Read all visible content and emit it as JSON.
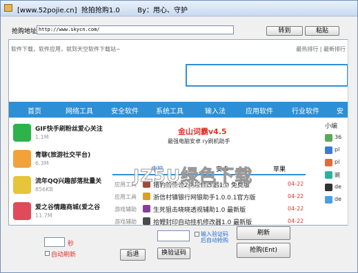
{
  "window": {
    "title": "[www.52pojie.cn]  抢拍抢购1.0        By：用心、守护"
  },
  "address": {
    "label": "抢购地址:",
    "value": "http://www.skycn.com/",
    "goto_label": "转到",
    "paste_label": "粘贴"
  },
  "browser": {
    "top_text": "软件下载，软件应用，就到天空软件下载站~",
    "top_links": "最热排行 | 最新排行",
    "nav": [
      "首页",
      "网络工具",
      "安全软件",
      "系统工具",
      "输入法",
      "应用软件",
      "行业软件",
      "安"
    ],
    "left_items": [
      {
        "name": "GIF快手刷粉丝爱心关注",
        "size": "1.1M",
        "icon": "gif-app-icon",
        "color": "#2eb34a"
      },
      {
        "name": "青聊(旅游社交平台)",
        "size": "6.3M",
        "icon": "dog-app-icon",
        "color": "#f0a33a"
      },
      {
        "name": "流年QQ兴趣部落批量关",
        "size": "856KB",
        "icon": "zhiyi-app-icon",
        "color": "#e6c53a"
      },
      {
        "name": "爱之谷情趣商城(爱之谷",
        "size": "11.7M",
        "icon": "heart-app-icon",
        "color": "#e04b5a"
      }
    ],
    "featured": {
      "title": "金山词霸v4.5",
      "subtitle": "最强电脑安卓 ry刷机助手"
    },
    "tabs": [
      "电脑",
      "安卓",
      "苹果"
    ],
    "rows": [
      {
        "category": "应用工具",
        "title": "猎豹的传说2两项修改器1.0 免费版",
        "date": "04-22",
        "color": "#a5463b"
      },
      {
        "category": "应用工具",
        "title": "浙信村镇银行网银助手1.0.0.1官方版",
        "date": "04-22",
        "color": "#d8a12a"
      },
      {
        "category": "游戏辅助",
        "title": "生死狙击晓晓透视辅助1.0 最新版",
        "date": "04-22",
        "color": "#8a3b9c"
      },
      {
        "category": "游戏辅助",
        "title": "拾鲤封印自动挂机修改器1.0 最新版",
        "date": "04-22",
        "color": "#4a4a4a"
      }
    ],
    "right_head": "小编",
    "right_items": [
      {
        "text": "36",
        "color": "#5ba85a"
      },
      {
        "text": "pl",
        "color": "#3a7bd5"
      },
      {
        "text": "pl",
        "color": "#e36b3a"
      },
      {
        "text": "豌",
        "color": "#2bb39a"
      },
      {
        "text": "de",
        "color": "#333333"
      },
      {
        "text": "de",
        "color": "#4aa0e0"
      }
    ],
    "watermark": "JZ5U绿色下载",
    "watermark_url": "www.jz5u.com"
  },
  "controls": {
    "seconds_unit": "秒",
    "auto_refresh_label": "自动刷新",
    "back_label": "后退",
    "change_captcha_label": "换验证码",
    "input_captcha_label": "输入验证码",
    "captcha_hint": "后自动抢购",
    "refresh_label": "刷新",
    "buy_label": "抢购(Ent)"
  },
  "colors": {
    "accent": "#2d8fd5",
    "red": "#e0342b"
  }
}
